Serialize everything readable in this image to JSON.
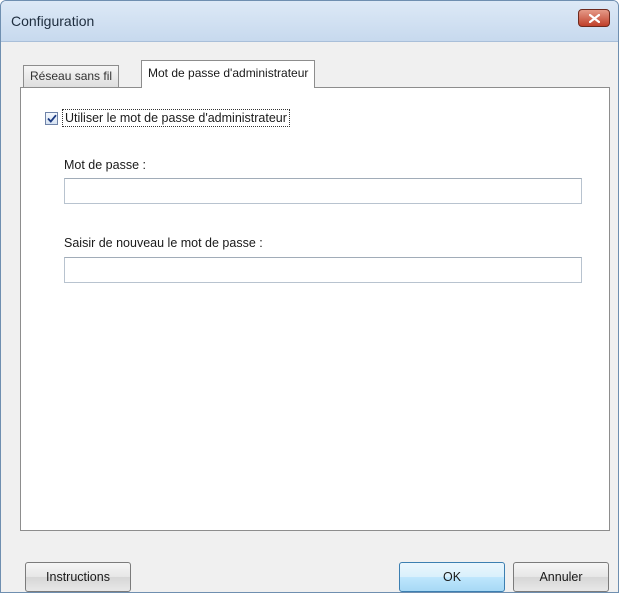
{
  "window": {
    "title": "Configuration"
  },
  "tabs": [
    {
      "label": "Réseau sans fil",
      "active": false
    },
    {
      "label": "Mot de passe d'administrateur",
      "active": true
    }
  ],
  "panel": {
    "use_admin_password": {
      "label": "Utiliser le mot de passe d'administrateur",
      "checked": true
    },
    "password": {
      "label": "Mot de passe :",
      "value": ""
    },
    "confirm_password": {
      "label": "Saisir de nouveau le mot de passe :",
      "value": ""
    }
  },
  "buttons": {
    "instructions": "Instructions",
    "ok": "OK",
    "cancel": "Annuler"
  }
}
